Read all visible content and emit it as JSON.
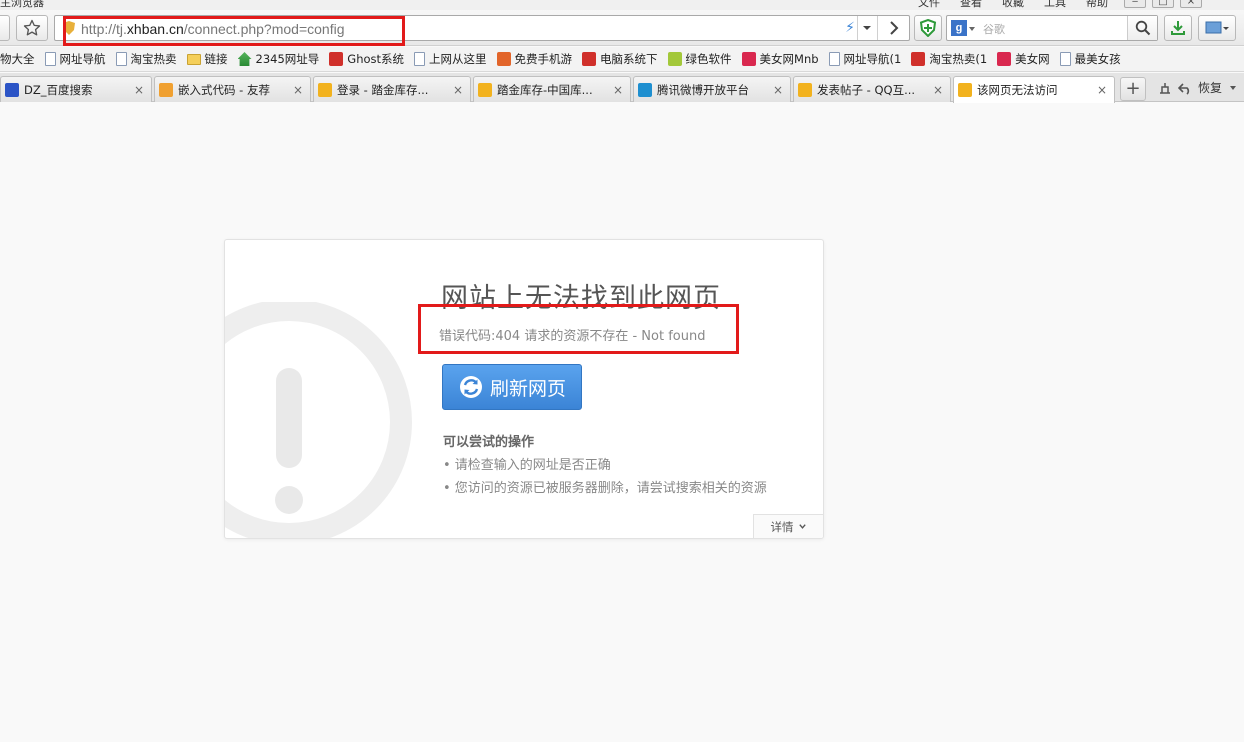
{
  "window": {
    "title": "主浏览器",
    "menus": [
      "文件",
      "查看",
      "收藏",
      "工具",
      "帮助"
    ]
  },
  "toolbar": {
    "url_prefix": "http://tj.",
    "url_domain": "xhban.cn",
    "url_path": "/connect.php?mod=config",
    "search_placeholder": "谷歌",
    "search_engine_letter": "g"
  },
  "bookmarks": [
    {
      "label": "物大全",
      "icon": "none"
    },
    {
      "label": "网址导航",
      "icon": "page"
    },
    {
      "label": "淘宝热卖",
      "icon": "page"
    },
    {
      "label": "链接",
      "icon": "folder"
    },
    {
      "label": "2345网址导",
      "icon": "house"
    },
    {
      "label": "Ghost系统",
      "icon": "red"
    },
    {
      "label": "上网从这里",
      "icon": "page"
    },
    {
      "label": "免费手机游",
      "icon": "orange"
    },
    {
      "label": "电脑系统下",
      "icon": "red"
    },
    {
      "label": "绿色软件",
      "icon": "green"
    },
    {
      "label": "美女网Mnb",
      "icon": "pink"
    },
    {
      "label": "网址导航(1",
      "icon": "page"
    },
    {
      "label": "淘宝热卖(1",
      "icon": "red"
    },
    {
      "label": "美女网",
      "icon": "pink"
    },
    {
      "label": "最美女孩",
      "icon": "page"
    }
  ],
  "tabs": [
    {
      "label": "DZ_百度搜索",
      "color": "#2b54c6"
    },
    {
      "label": "嵌入式代码 - 友荐",
      "color": "#f0a030"
    },
    {
      "label": "登录 - 踏金库存...",
      "color": "#f2b21e"
    },
    {
      "label": "踏金库存-中国库...",
      "color": "#f2b21e"
    },
    {
      "label": "腾讯微博开放平台",
      "color": "#1e8fd0"
    },
    {
      "label": "发表帖子 - QQ互...",
      "color": "#f2b21e"
    },
    {
      "label": "该网页无法访问",
      "color": "#f2b21e"
    }
  ],
  "tab_close": "×",
  "tabs_right": {
    "new_tab": "+",
    "restore": "恢复"
  },
  "error_page": {
    "title": "网站上无法找到此网页",
    "error_code": "错误代码:404 请求的资源不存在 - Not found",
    "refresh_button": "刷新网页",
    "try_title": "可以尝试的操作",
    "suggestions": [
      "• 请检查输入的网址是否正确",
      "• 您访问的资源已被服务器删除，请尝试搜索相关的资源"
    ],
    "details_button": "详情"
  },
  "colors": {
    "highlight": "#e21a1a",
    "button_blue": "#3b84d6"
  }
}
